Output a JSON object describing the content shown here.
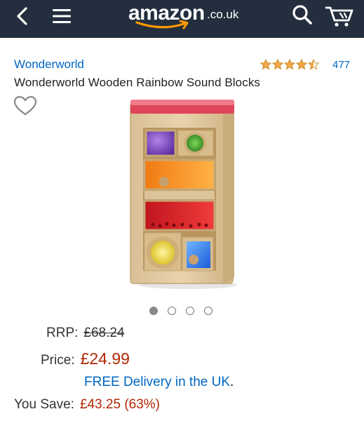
{
  "header": {
    "logo_word": "amazon",
    "logo_tld": ".co.uk",
    "colors": {
      "bar": "#232f3e",
      "logo_smile": "#ff9900"
    },
    "icons": [
      "back-arrow-icon",
      "hamburger-menu-icon",
      "search-icon",
      "cart-icon"
    ]
  },
  "product": {
    "brand": "Wonderworld",
    "title": "Wonderworld Wooden Rainbow Sound Blocks",
    "rating": {
      "stars": 4.5,
      "count": "477"
    },
    "image_alt": "Wooden rainbow sound blocks tower",
    "carousel": {
      "total": 4,
      "active": 1
    }
  },
  "pricing": {
    "rrp_label": "RRP:",
    "rrp_value": "£68.24",
    "price_label": "Price:",
    "price_value": "£24.99",
    "delivery_text": "FREE Delivery in the UK",
    "delivery_suffix": ".",
    "save_label": "You Save:",
    "save_value": "£43.25 (63%)",
    "colors": {
      "price": "#b12704",
      "link": "#0066c0"
    }
  }
}
